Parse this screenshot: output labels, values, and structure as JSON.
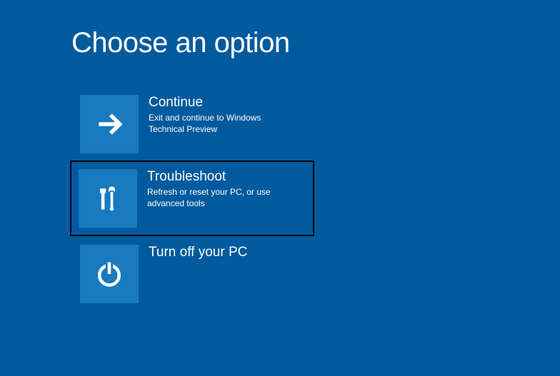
{
  "page": {
    "title": "Choose an option"
  },
  "options": [
    {
      "title": "Continue",
      "desc": "Exit and continue to Windows Technical Preview",
      "icon": "arrow-right",
      "highlighted": false
    },
    {
      "title": "Troubleshoot",
      "desc": "Refresh or reset your PC, or use advanced tools",
      "icon": "tools",
      "highlighted": true
    },
    {
      "title": "Turn off your PC",
      "desc": "",
      "icon": "power",
      "highlighted": false
    }
  ],
  "colors": {
    "background": "#005A9E",
    "tile": "#187ABF",
    "highlight_border": "#000000"
  }
}
